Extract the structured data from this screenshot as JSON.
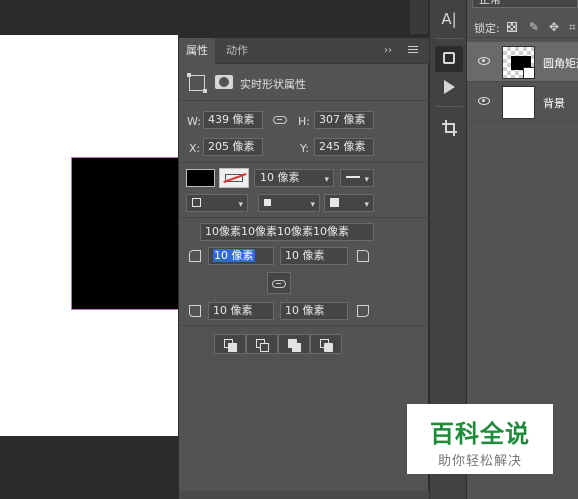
{
  "properties_panel": {
    "tabs": [
      "属性",
      "动作"
    ],
    "collapse_label": "››",
    "header_title": "实时形状属性",
    "w_label": "W:",
    "w_value": "439 像素",
    "h_label": "H:",
    "h_value": "307 像素",
    "x_label": "X:",
    "x_value": "205 像素",
    "y_label": "Y:",
    "y_value": "245 像素",
    "stroke_width": "10 像素",
    "corner_all": "10像素10像素10像素10像素",
    "corner_tl": "10 像素",
    "corner_tr": "10 像素",
    "corner_bl": "10 像素",
    "corner_br": "10 像素"
  },
  "tools": {
    "text_tool_glyph": "A|"
  },
  "layers_panel": {
    "blend_mode": "正常",
    "lock_label": "锁定:",
    "layers": [
      {
        "name": "圆角矩形",
        "selected": true
      },
      {
        "name": "背景",
        "selected": false
      }
    ]
  },
  "watermark": {
    "title": "百科全说",
    "subtitle": "助你轻松解决"
  },
  "colors": {
    "fill": "#000000",
    "panel_bg": "#535353",
    "selection_blue": "#2f6ad8",
    "watermark_green": "#1f8a3a"
  }
}
